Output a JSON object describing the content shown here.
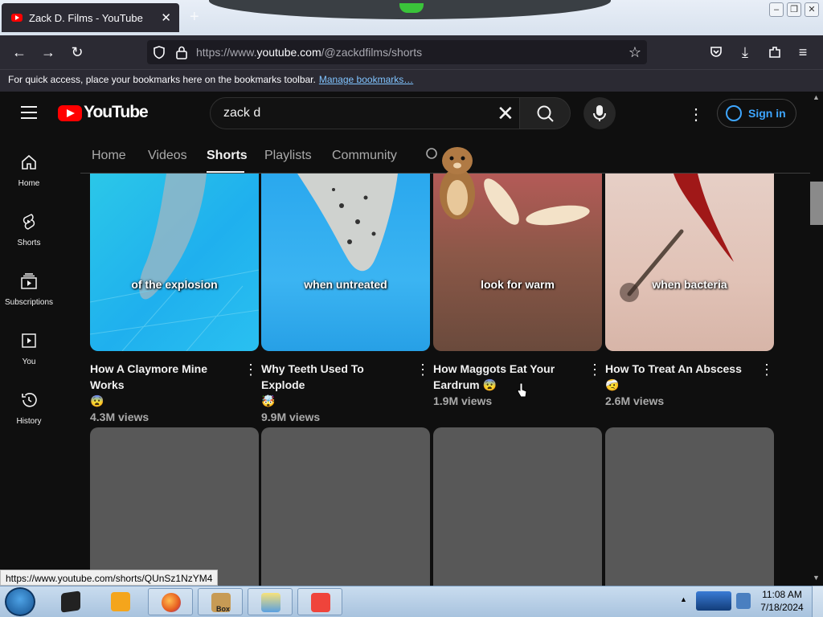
{
  "browser": {
    "tab_title": "Zack D. Films - YouTube",
    "tab_close": "✕",
    "new_tab": "+",
    "url_prefix": "https://www.",
    "url_domain": "youtube.com",
    "url_path": "/@zackdfilms/shorts",
    "bookmarks_text": "For quick access, place your bookmarks here on the bookmarks toolbar.",
    "bookmarks_link": "Manage bookmarks…",
    "status_url": "https://www.youtube.com/shorts/QUnSz1NzYM4"
  },
  "youtube": {
    "logo_text": "YouTube",
    "search_value": "zack d",
    "sign_in": "Sign in",
    "nav": [
      {
        "label": "Home",
        "icon": "home-icon"
      },
      {
        "label": "Shorts",
        "icon": "shorts-icon"
      },
      {
        "label": "Subscriptions",
        "icon": "subscriptions-icon"
      },
      {
        "label": "You",
        "icon": "you-icon"
      },
      {
        "label": "History",
        "icon": "history-icon"
      }
    ],
    "tabs": [
      "Home",
      "Videos",
      "Shorts",
      "Playlists",
      "Community"
    ],
    "active_tab": "Shorts",
    "shorts": [
      {
        "caption": "of the explosion",
        "title_line1": "How A Claymore Mine Works",
        "title_line2": "😨",
        "views": "4.3M views"
      },
      {
        "caption": "when untreated",
        "title_line1": "Why Teeth Used To Explode",
        "title_line2": "🤯",
        "views": "9.9M views"
      },
      {
        "caption": "look for warm",
        "title_line1": "How Maggots Eat Your",
        "title_line2": "Eardrum 😨",
        "views": "1.9M views"
      },
      {
        "caption": "when bacteria",
        "title_line1": "How To Treat An Abscess 🤕",
        "title_line2": "",
        "views": "2.6M views"
      }
    ]
  },
  "taskbar": {
    "time": "11:08 AM",
    "date": "7/18/2024",
    "box_label": "Box"
  }
}
